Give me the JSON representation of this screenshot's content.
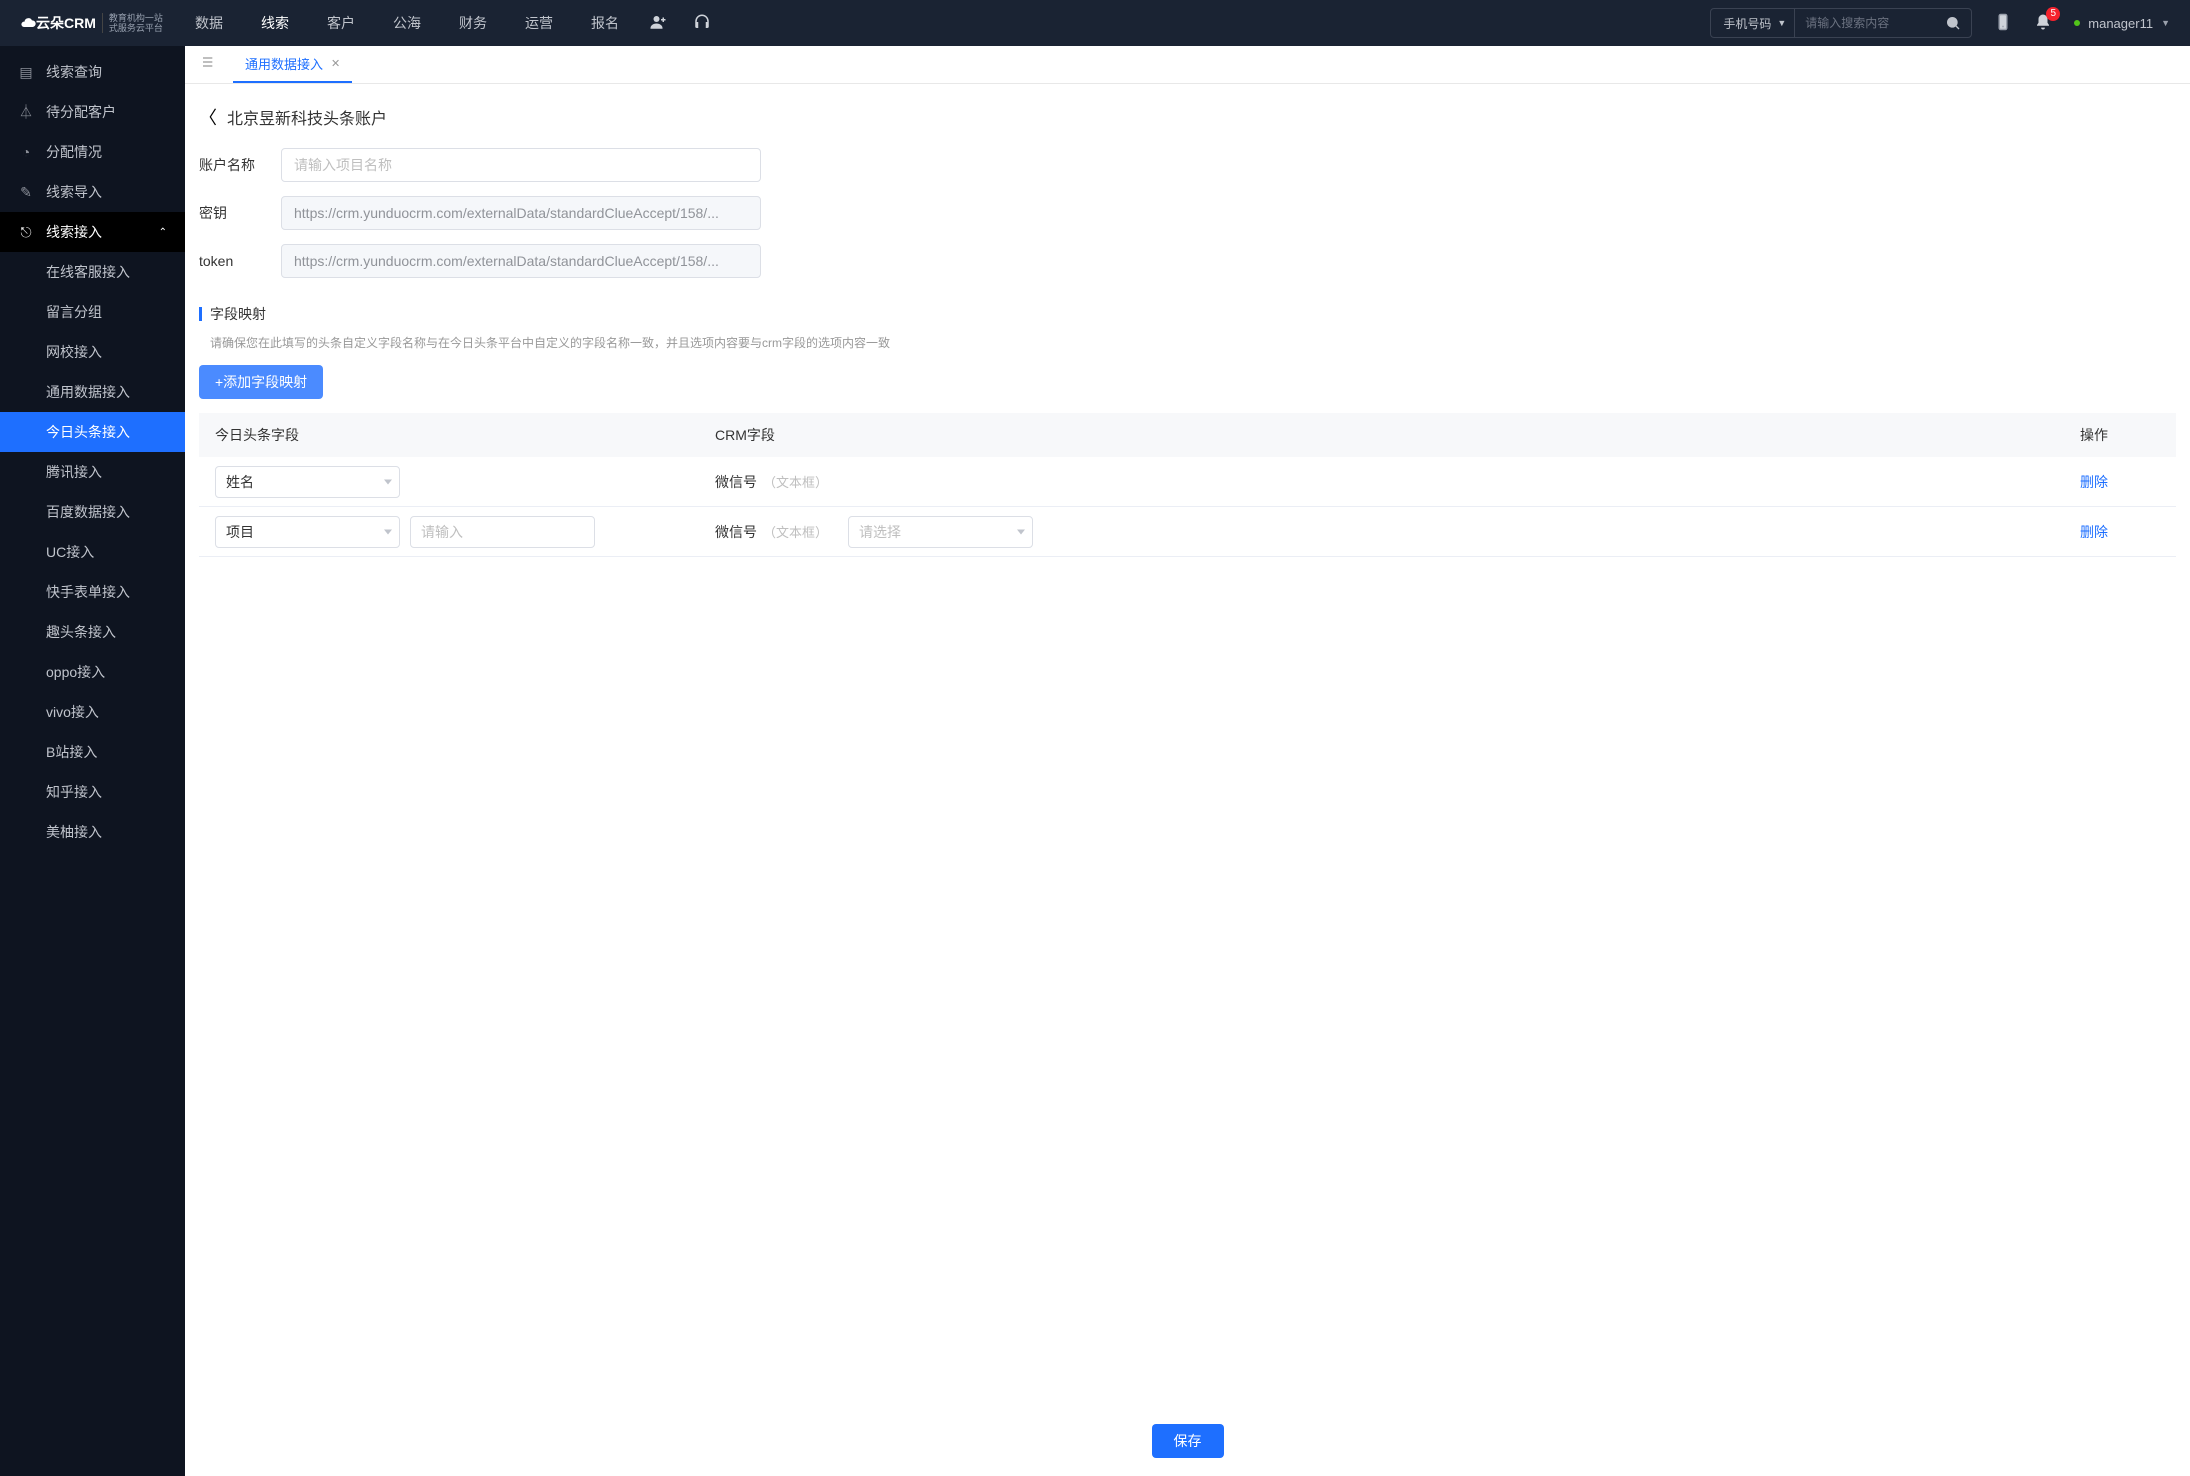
{
  "brand": {
    "name": "云朵CRM",
    "sub1": "教育机构一站",
    "sub2": "式服务云平台",
    "url": "www.yunduocrm.com"
  },
  "nav": {
    "items": [
      "数据",
      "线索",
      "客户",
      "公海",
      "财务",
      "运营",
      "报名"
    ],
    "activeIndex": 1
  },
  "search": {
    "selectLabel": "手机号码",
    "placeholder": "请输入搜索内容"
  },
  "notif": {
    "count": "5"
  },
  "user": {
    "name": "manager11"
  },
  "sidebar": {
    "top": [
      {
        "label": "线索查询"
      },
      {
        "label": "待分配客户"
      },
      {
        "label": "分配情况"
      },
      {
        "label": "线索导入"
      }
    ],
    "accessLabel": "线索接入",
    "subs": [
      "在线客服接入",
      "留言分组",
      "网校接入",
      "通用数据接入",
      "今日头条接入",
      "腾讯接入",
      "百度数据接入",
      "UC接入",
      "快手表单接入",
      "趣头条接入",
      "oppo接入",
      "vivo接入",
      "B站接入",
      "知乎接入",
      "美柚接入"
    ],
    "activeSubIndex": 4
  },
  "tab": {
    "label": "通用数据接入"
  },
  "page": {
    "title": "北京昱新科技头条账户",
    "accountLabel": "账户名称",
    "accountPlaceholder": "请输入项目名称",
    "secretLabel": "密钥",
    "secretValue": "https://crm.yunduocrm.com/externalData/standardClueAccept/158/...",
    "tokenLabel": "token",
    "tokenValue": "https://crm.yunduocrm.com/externalData/standardClueAccept/158/..."
  },
  "mapping": {
    "sectionTitle": "字段映射",
    "desc": "请确保您在此填写的头条自定义字段名称与在今日头条平台中自定义的字段名称一致，并且选项内容要与crm字段的选项内容一致",
    "addBtn": "+添加字段映射",
    "headers": [
      "今日头条字段",
      "CRM字段",
      "操作"
    ],
    "rows": [
      {
        "fieldSelect": "姓名",
        "extraInput": false,
        "crmName": "微信号",
        "crmType": "（文本框）",
        "crmSelect": false,
        "del": "删除"
      },
      {
        "fieldSelect": "项目",
        "extraInput": true,
        "extraPlaceholder": "请输入",
        "crmName": "微信号",
        "crmType": "（文本框）",
        "crmSelect": true,
        "crmSelectPlaceholder": "请选择",
        "del": "删除"
      }
    ]
  },
  "footer": {
    "save": "保存"
  }
}
